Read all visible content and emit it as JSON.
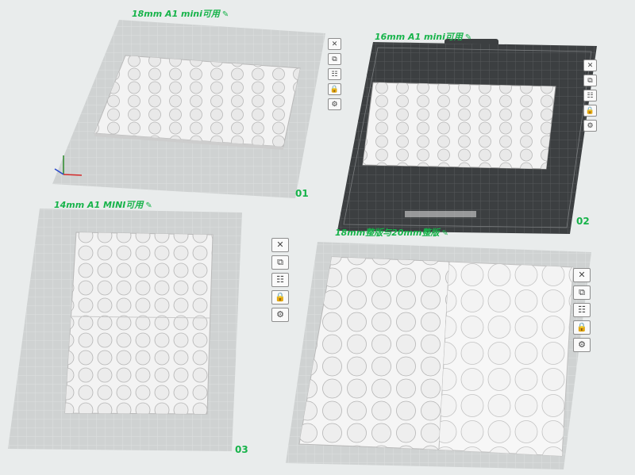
{
  "plates": [
    {
      "id": "plate-01",
      "label": "18mm A1 mini可用",
      "number": "01",
      "type": "grey",
      "grid": "6x5"
    },
    {
      "id": "plate-02",
      "label": "16mm A1 mini可用",
      "number": "02",
      "type": "textured",
      "grid": "6x5"
    },
    {
      "id": "plate-03",
      "label": "14mm A1 MINI可用",
      "number": "03",
      "type": "grey",
      "grid": "7x11"
    },
    {
      "id": "plate-04",
      "label": "18mm整版与20mm整版",
      "number": "",
      "type": "grey",
      "grid": "6x10+5x8"
    }
  ],
  "toolbar_icons": [
    "close-icon",
    "auto-arrange-icon",
    "plate-settings-icon",
    "lock-icon",
    "gear-icon"
  ],
  "colors": {
    "accent": "#17b34a",
    "plate_grey": "#cfd2d2",
    "plate_dark": "#3c3f41",
    "model": "#f2f2f2"
  }
}
